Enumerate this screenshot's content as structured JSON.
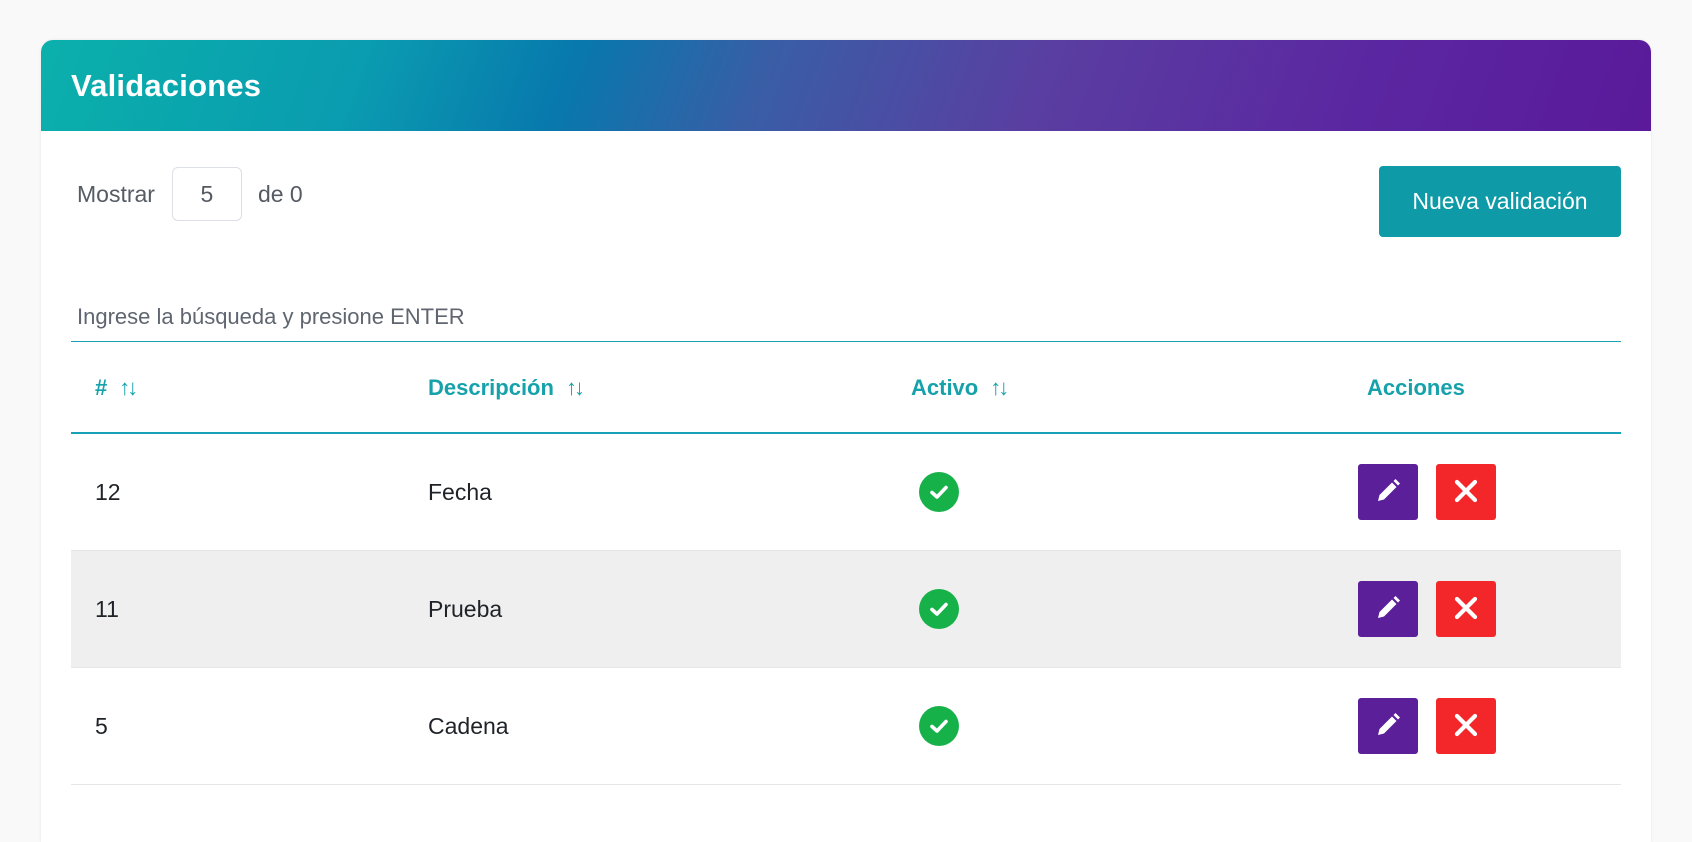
{
  "card": {
    "title": "Validaciones"
  },
  "pagination": {
    "show_label": "Mostrar",
    "page_size": "5",
    "of_label": "de 0"
  },
  "toolbar": {
    "new_label": "Nueva validación"
  },
  "search": {
    "placeholder": "Ingrese la búsqueda y presione ENTER"
  },
  "table": {
    "columns": [
      {
        "label": "#",
        "sortable": true
      },
      {
        "label": "Descripción",
        "sortable": true
      },
      {
        "label": "Activo",
        "sortable": true
      },
      {
        "label": "Acciones",
        "sortable": false
      }
    ],
    "sort_icon": "↑↓",
    "rows": [
      {
        "id": "12",
        "description": "Fecha",
        "active": true
      },
      {
        "id": "11",
        "description": "Prueba",
        "active": true
      },
      {
        "id": "5",
        "description": "Cadena",
        "active": true
      }
    ]
  },
  "icons": {
    "active": "check-circle-icon",
    "edit": "pencil-icon",
    "delete": "close-icon"
  },
  "colors": {
    "header_gradient_start": "#0bb0ab",
    "header_gradient_end": "#5a1a9a",
    "accent": "#17a2ab",
    "primary_button": "#0e9aa7",
    "edit_button": "#5b1f99",
    "delete_button": "#f3262a",
    "active_check": "#17b14a"
  }
}
